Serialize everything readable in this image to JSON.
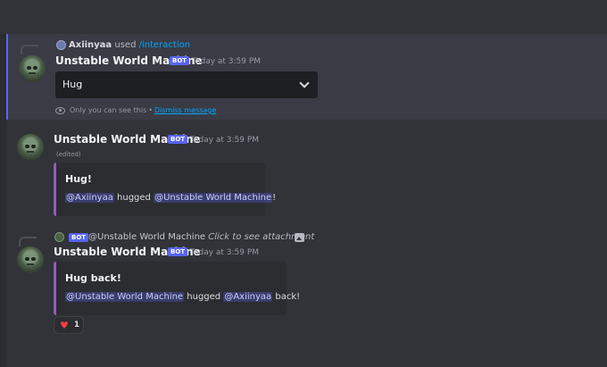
{
  "messages": [
    {
      "reply": {
        "user": "Axiinyaa",
        "used": "used",
        "command": "/interaction"
      },
      "username": "Unstable World Machine",
      "bot_tag": "BOT",
      "timestamp": "Today at 3:59 PM",
      "select": {
        "value": "Hug"
      },
      "ephemeral": {
        "notice": "Only you can see this",
        "separator": "•",
        "dismiss": "Dismiss message"
      }
    },
    {
      "username": "Unstable World Machine",
      "bot_tag": "BOT",
      "timestamp": "Today at 3:59 PM",
      "edited": "(edited)",
      "embed": {
        "title": "Hug!",
        "mention_1": "@Axiinyaa",
        "verb": "hugged",
        "mention_2": "@Unstable World Machine",
        "suffix": "!"
      }
    },
    {
      "reply": {
        "bot_tag": "BOT",
        "user": "@Unstable World Machine",
        "text": "Click to see attachment"
      },
      "username": "Unstable World Machine",
      "bot_tag": "BOT",
      "timestamp": "Today at 3:59 PM",
      "embed": {
        "title": "Hug back!",
        "mention_1": "@Unstable World Machine",
        "verb": "hugged",
        "mention_2": "@Axiinyaa",
        "suffix": "back!"
      },
      "reaction": {
        "emoji": "♥",
        "count": "1"
      }
    }
  ],
  "colors": {
    "background": "#313338",
    "blurple": "#5865f2",
    "embed_accent": "#9b59b6",
    "link": "#00a8fc"
  }
}
